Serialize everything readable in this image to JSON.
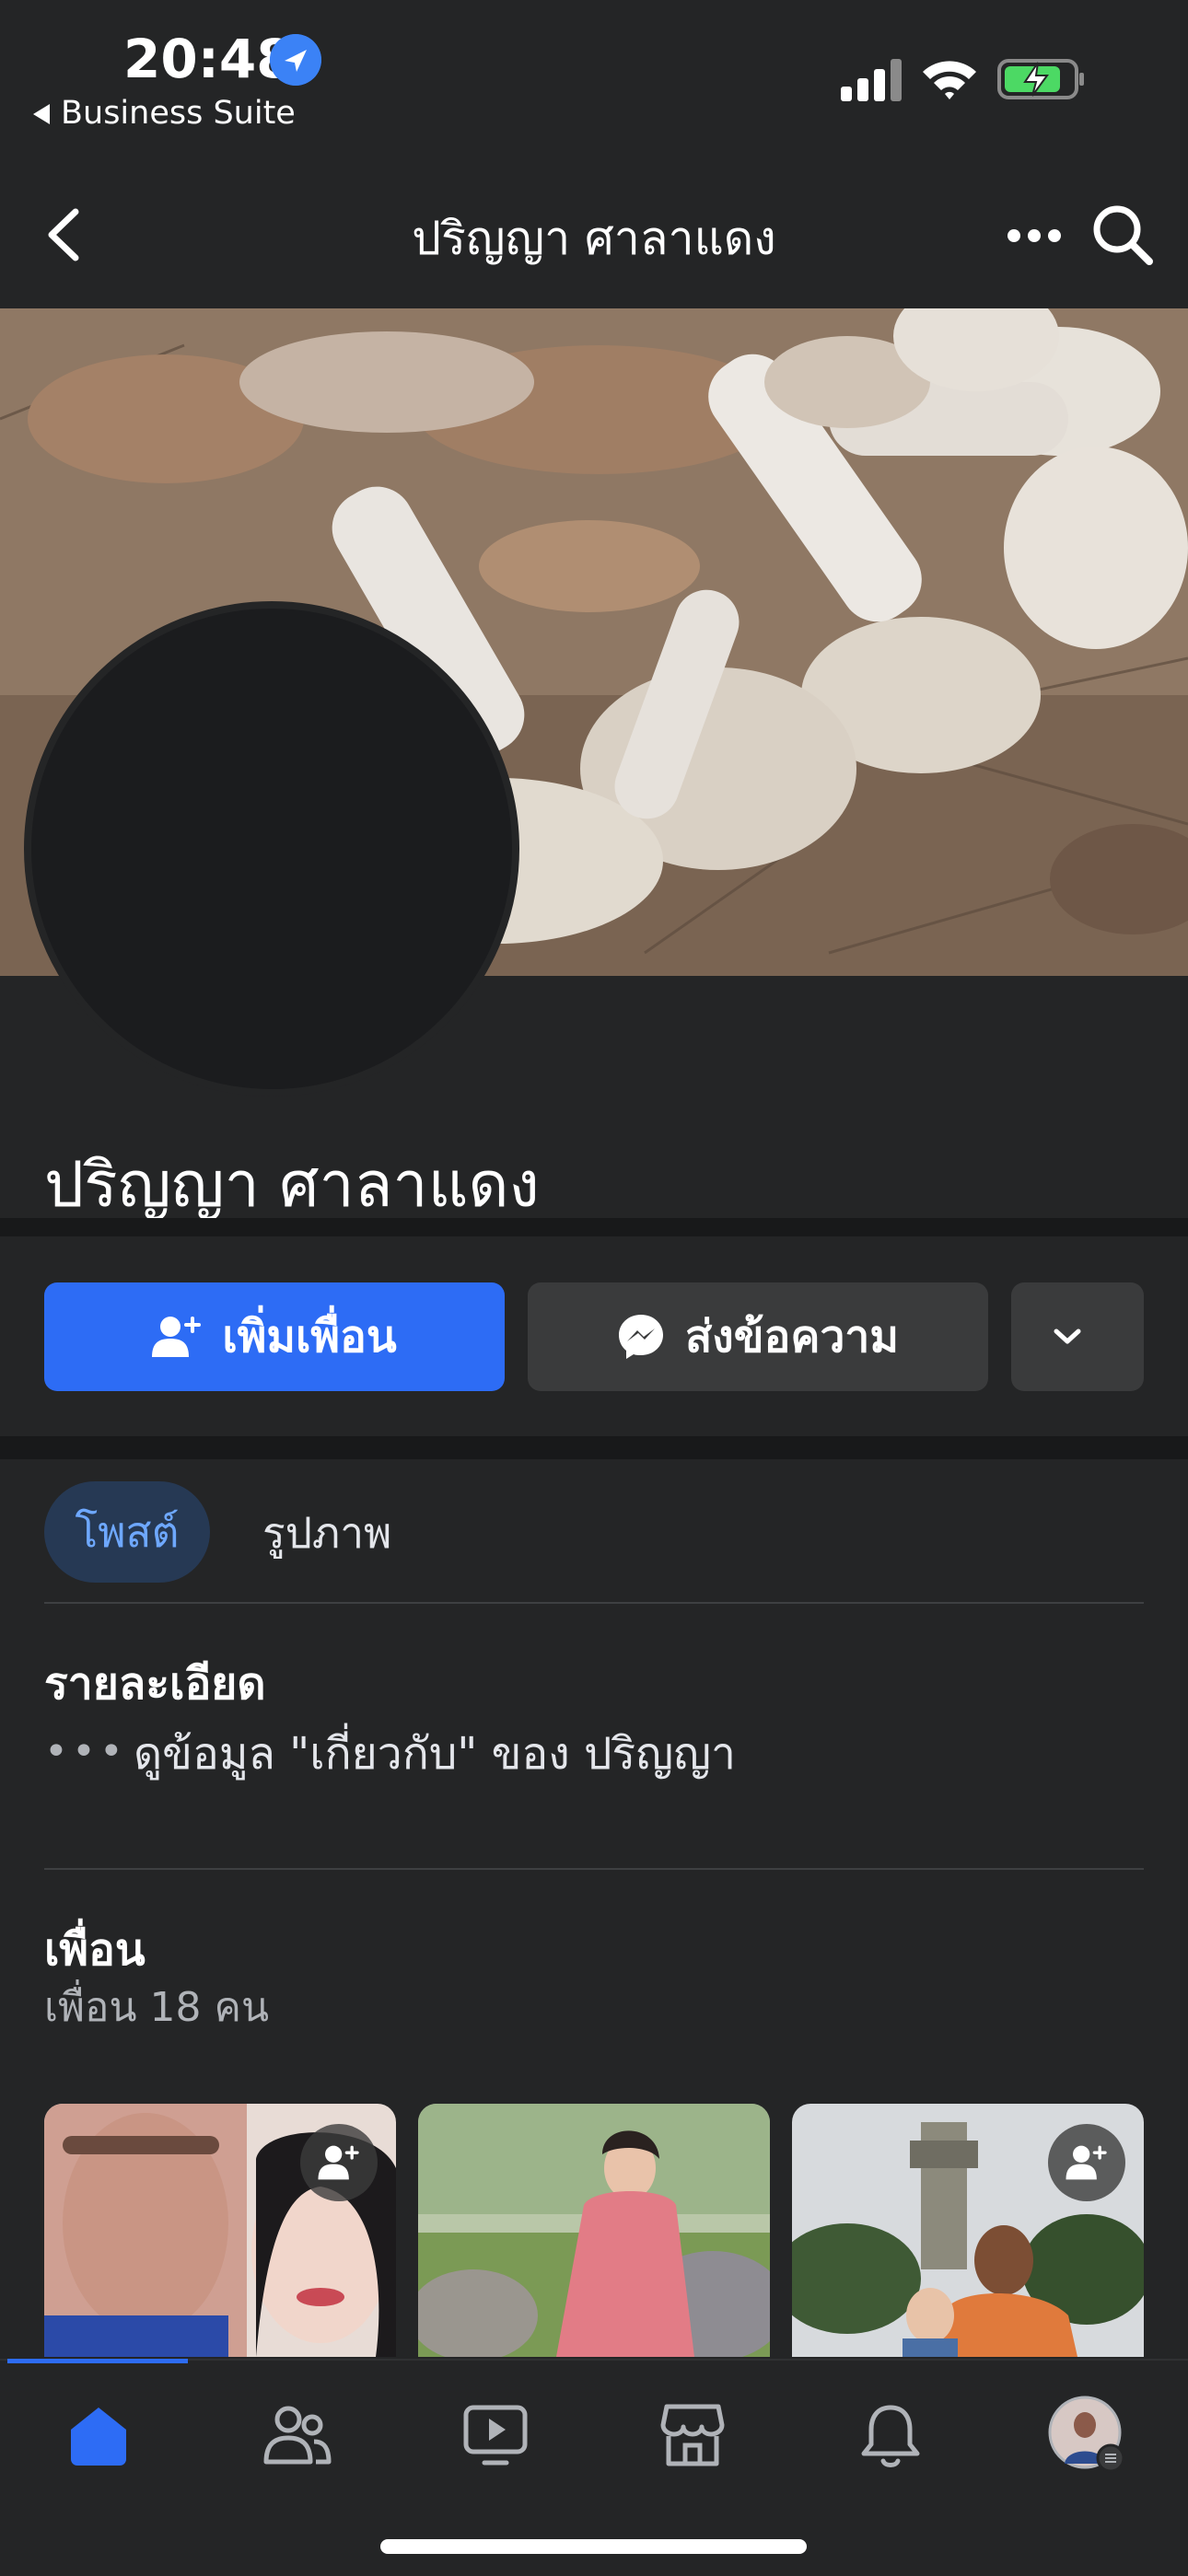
{
  "status_bar": {
    "time": "20:48",
    "back_app": "Business Suite"
  },
  "header": {
    "title": "ปริญญา ศาลาแดง"
  },
  "profile": {
    "name": "ปริญญา ศาลาแดง"
  },
  "actions": {
    "add_friend_label": "เพิ่มเพื่อน",
    "message_label": "ส่งข้อความ"
  },
  "tabs": [
    {
      "label": "โพสต์",
      "active": true
    },
    {
      "label": "รูปภาพ",
      "active": false
    }
  ],
  "details": {
    "heading": "รายละเอียด",
    "dots": "•••",
    "about_link": "ดูข้อมูล \"เกี่ยวกับ\" ของ ปริญญา"
  },
  "friends": {
    "heading": "เพื่อน",
    "count_label": "เพื่อน 18 คน"
  },
  "colors": {
    "accent": "#2d6cf5",
    "background": "#242526",
    "active_tab_bg": "#263954",
    "active_tab_text": "#6ea8ff"
  },
  "bottom_nav": [
    "home-icon",
    "friends-icon",
    "video-icon",
    "marketplace-icon",
    "bell-icon",
    "profile-avatar"
  ]
}
